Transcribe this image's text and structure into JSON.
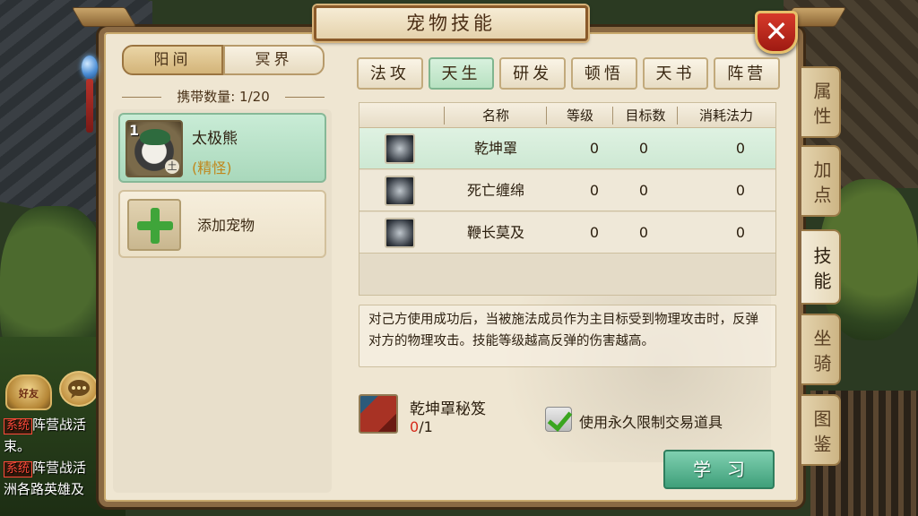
{
  "window": {
    "title": "宠物技能",
    "close_label": "✕"
  },
  "realm_tabs": [
    {
      "label": "阳间",
      "active": true
    },
    {
      "label": "冥界",
      "active": false
    }
  ],
  "carry": {
    "text": "携带数量: 1/20"
  },
  "pet_list": [
    {
      "level": "1",
      "name": "太极熊",
      "type": "(精怪)",
      "element": "土",
      "selected": true
    }
  ],
  "add_pet": {
    "label": "添加宠物"
  },
  "skill_tabs": [
    {
      "label": "法攻",
      "active": false
    },
    {
      "label": "天生",
      "active": true
    },
    {
      "label": "研发",
      "active": false
    },
    {
      "label": "顿悟",
      "active": false
    },
    {
      "label": "天书",
      "active": false
    },
    {
      "label": "阵营",
      "active": false
    }
  ],
  "skill_table": {
    "columns": [
      "名称",
      "等级",
      "目标数",
      "消耗法力"
    ],
    "rows": [
      {
        "icon": "shield-skill-icon",
        "name": "乾坤罩",
        "level": "0",
        "targets": "0",
        "mana": "0",
        "selected": true
      },
      {
        "icon": "skull-skill-icon",
        "name": "死亡缠绵",
        "level": "0",
        "targets": "0",
        "mana": "0",
        "selected": false
      },
      {
        "icon": "whip-skill-icon",
        "name": "鞭长莫及",
        "level": "0",
        "targets": "0",
        "mana": "0",
        "selected": false
      }
    ]
  },
  "description": "对己方使用成功后，当被施法成员作为主目标受到物理攻击时，反弹对方的物理攻击。技能等级越高反弹的伤害越高。",
  "book": {
    "name": "乾坤罩秘笈",
    "have": "0",
    "need": "/1"
  },
  "use_permanent": {
    "checked": true,
    "label": "使用永久限制交易道具"
  },
  "learn_button": {
    "label": "学习"
  },
  "side_tabs": [
    {
      "label": "属性",
      "active": false
    },
    {
      "label": "加点",
      "active": false
    },
    {
      "label": "技能",
      "active": true
    },
    {
      "label": "坐骑",
      "active": false
    },
    {
      "label": "图鉴",
      "active": false
    }
  ],
  "hud": {
    "friend_label": "好友",
    "chat_lines": [
      {
        "tag": "系统",
        "text": "阵营战活"
      },
      {
        "tag": "",
        "text": "束。"
      },
      {
        "tag": "系统",
        "text": "阵营战活"
      },
      {
        "tag": "",
        "text": "洲各路英雄及"
      }
    ]
  },
  "colors": {
    "panel_bg": "#efe6d2",
    "selected_green": "#cde8d3",
    "close_red": "#c0281a",
    "count_red": "#d62a1a",
    "learn_green": "#3f9f7a"
  }
}
